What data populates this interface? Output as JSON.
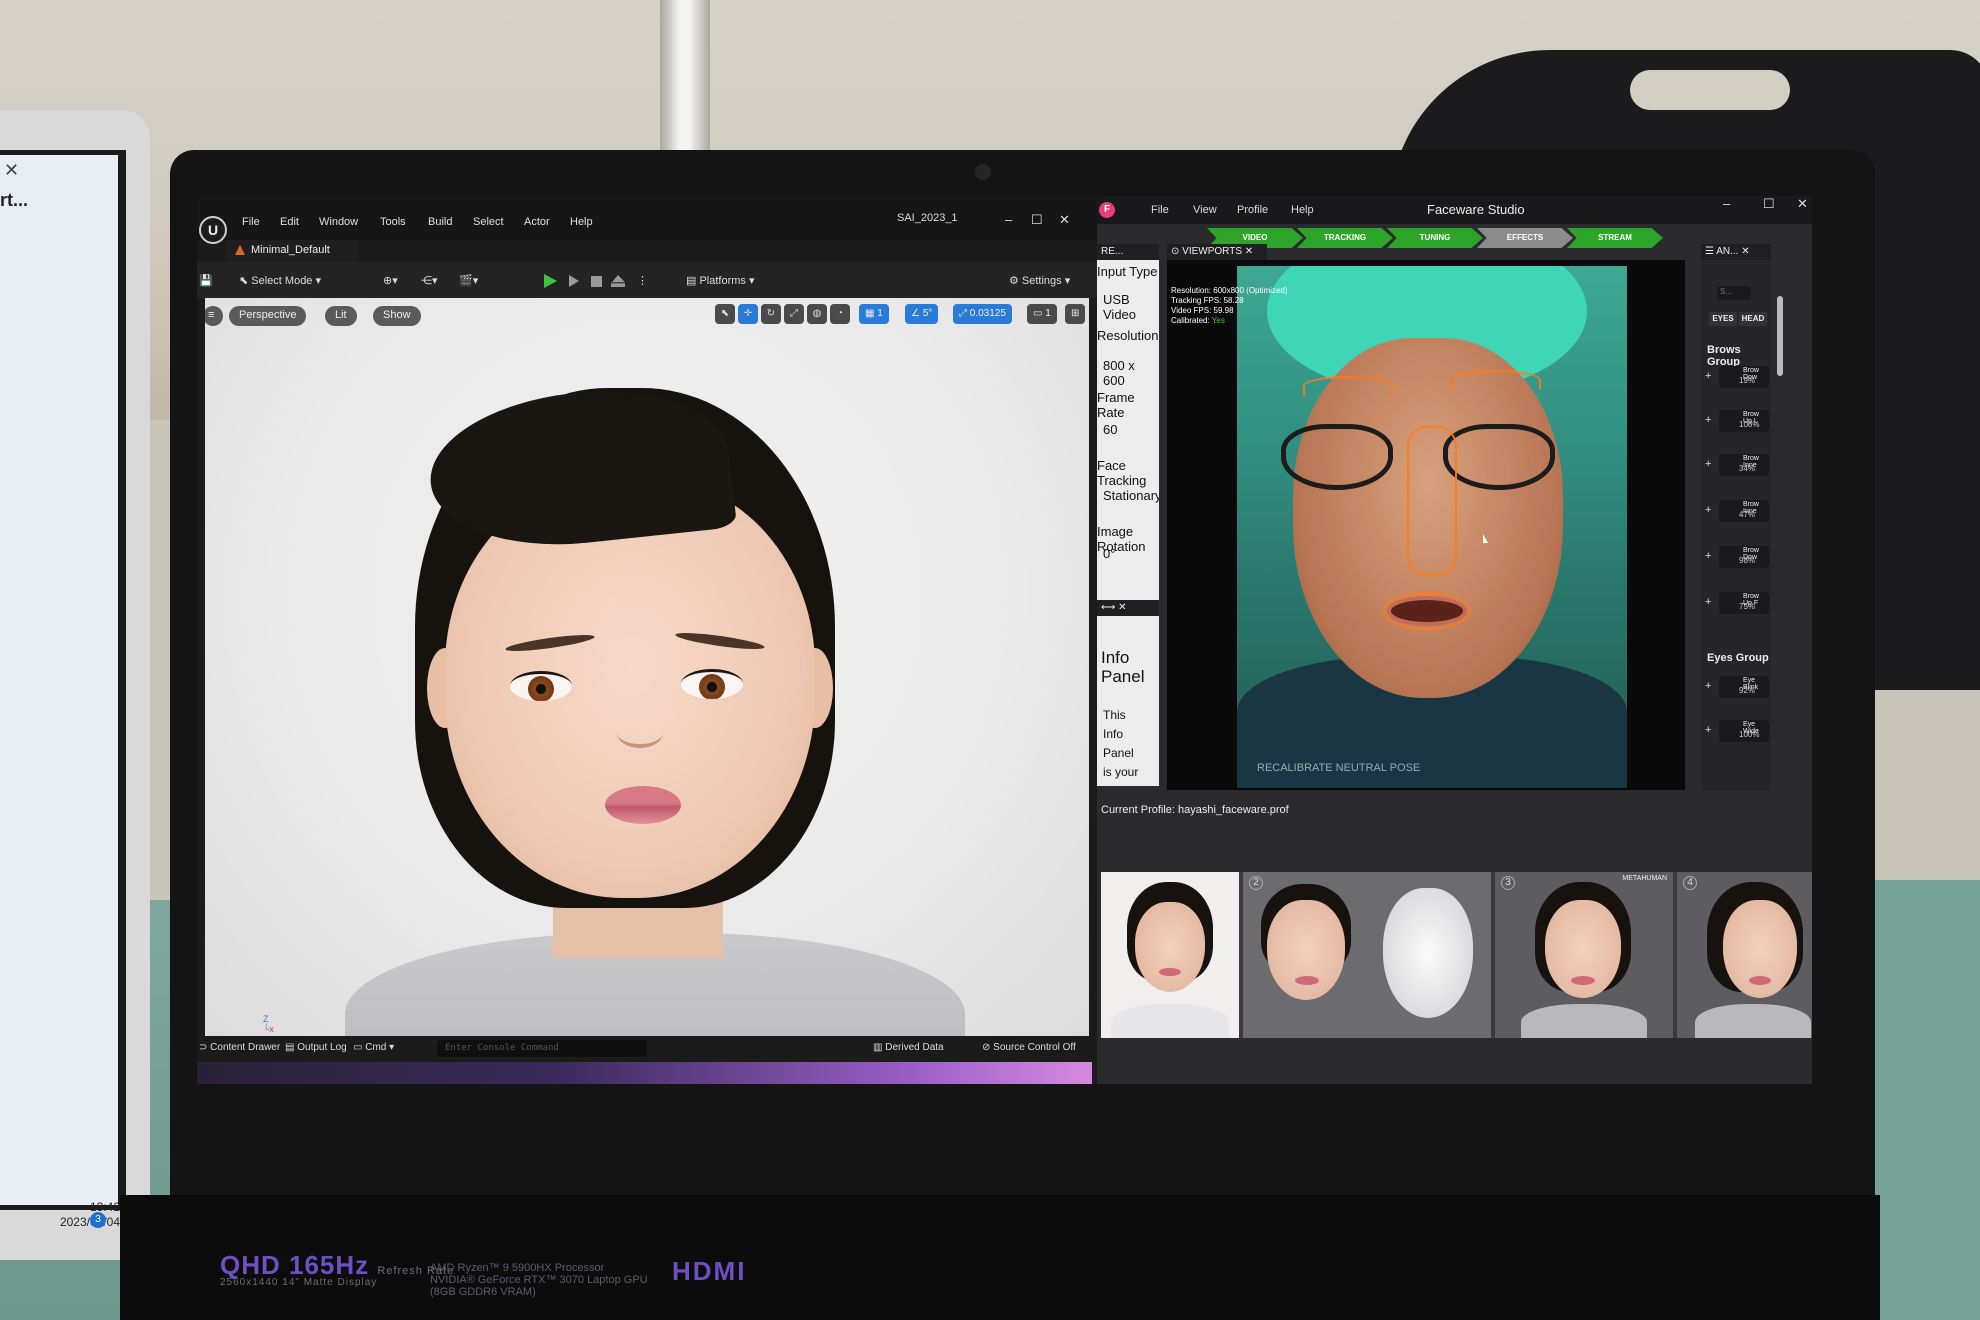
{
  "desktop_left": {
    "close_glyph": "✕",
    "title": "rt...",
    "clock_time": "13:42",
    "clock_date": "2023/07/04",
    "notif_count": "3"
  },
  "laptop": {
    "brand_line": "QHD 165Hz",
    "brand_sub": "Refresh Rate",
    "panel_spec": "2560x1440  14\" Matte Display",
    "cpu_line1": "AMD Ryzen™ 9 5900HX Processor",
    "cpu_line2": "NVIDIA® GeForce RTX™ 3070 Laptop GPU",
    "cpu_line3": "(8GB GDDR6 VRAM)",
    "port_label": "HDMI"
  },
  "unreal": {
    "menu": [
      "File",
      "Edit",
      "Window",
      "Tools",
      "Build",
      "Select",
      "Actor",
      "Help"
    ],
    "project_title": "SAI_2023_1",
    "level_tab": "Minimal_Default",
    "toolbar": {
      "select_mode": "Select Mode",
      "platforms": "Platforms",
      "settings": "Settings"
    },
    "viewport": {
      "perspective": "Perspective",
      "lit": "Lit",
      "show": "Show",
      "grid_snap": "1",
      "rot_snap": "5°",
      "scale_snap": "0.03125",
      "cam_speed": "1"
    },
    "statusbar": {
      "content_drawer": "Content Drawer",
      "output_log": "Output Log",
      "cmd": "Cmd",
      "console_placeholder": "Enter Console Command",
      "derived_data": "Derived Data",
      "source_control": "Source Control Off"
    }
  },
  "faceware": {
    "title": "Faceware Studio",
    "menu": [
      "File",
      "View",
      "Profile",
      "Help"
    ],
    "steps": [
      "VIDEO",
      "TRACKING",
      "TUNING",
      "EFFECTS",
      "STREAM"
    ],
    "realtime_tab": "RE...",
    "viewports_tab": "VIEWPORTS",
    "anim_tab": "AN...",
    "setup": [
      {
        "label": "Input Type",
        "value": "USB Video"
      },
      {
        "label": "Resolution",
        "value": "800 x 600"
      },
      {
        "label": "Frame Rate",
        "value": "60"
      },
      {
        "label": "Face Tracking",
        "value": "Stationary"
      },
      {
        "label": "Image Rotation",
        "value": "0°"
      }
    ],
    "info_title": "Info Panel",
    "info_body": [
      "This",
      "Info",
      "Panel",
      "is your"
    ],
    "readout": {
      "resolution": "Resolution: 600x800 (Optimized)",
      "tracking_fps": "Tracking FPS: 58.28",
      "video_fps": "Video FPS: 59.98",
      "calibrated_label": "Calibrated:",
      "calibrated_value": "Yes"
    },
    "recalibrate": "RECALIBRATE NEUTRAL POSE",
    "anim": {
      "search_placeholder": "S...",
      "tab_eyes": "EYES",
      "tab_head": "HEAD",
      "brows_group": "Brows Group",
      "brows": [
        {
          "name": "Brow Dow",
          "value": "19%"
        },
        {
          "name": "Brow Up L",
          "value": "108%"
        },
        {
          "name": "Brow Inne",
          "value": "34%"
        },
        {
          "name": "Brow Inne",
          "value": "47%"
        },
        {
          "name": "Brow Dow",
          "value": "98%"
        },
        {
          "name": "Brow Up F",
          "value": "75%"
        }
      ],
      "eyes_group": "Eyes Group",
      "eyes": [
        {
          "name": "Eye Blink",
          "value": "92%"
        },
        {
          "name": "Eye Wide",
          "value": "100%"
        }
      ]
    },
    "current_profile": "Current Profile: hayashi_faceware.prof",
    "thumbnails": [
      {
        "num": "",
        "tag": ""
      },
      {
        "num": "2",
        "tag": ""
      },
      {
        "num": "3",
        "tag": "METAHUMAN"
      },
      {
        "num": "4",
        "tag": ""
      }
    ]
  }
}
